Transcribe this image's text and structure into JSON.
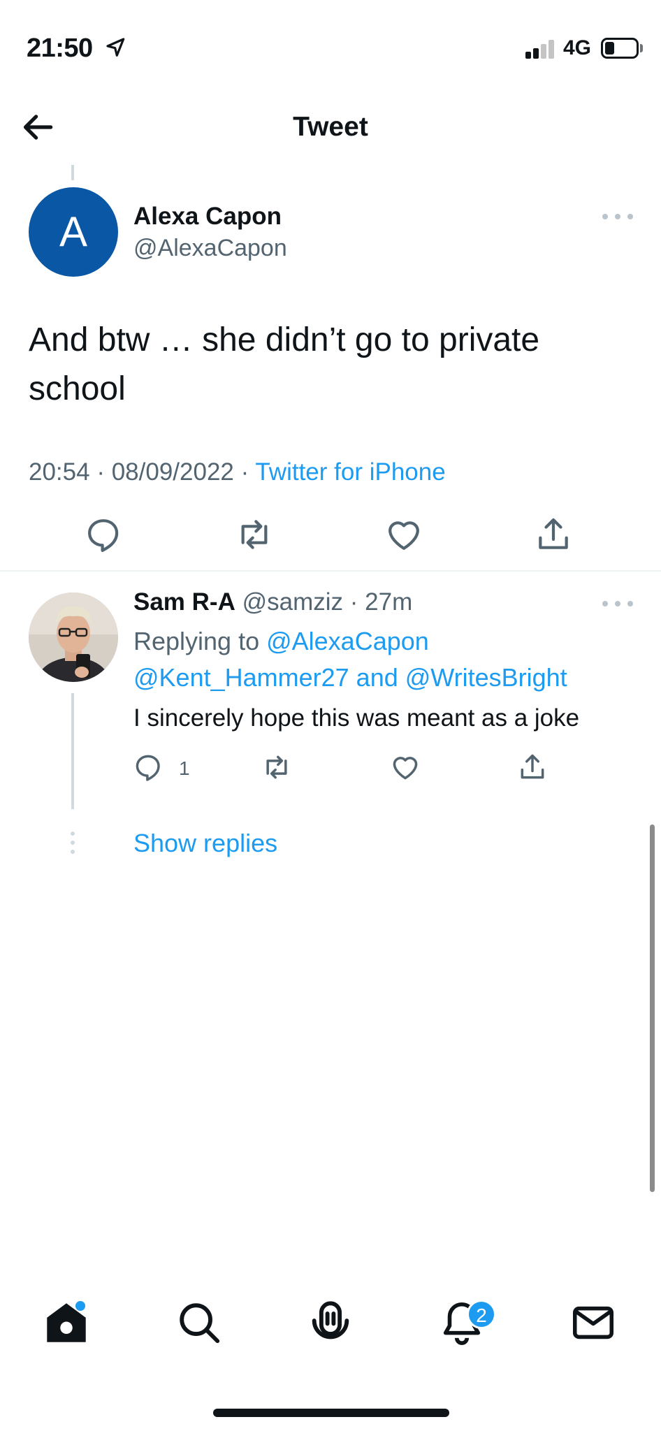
{
  "status_bar": {
    "time": "21:50",
    "network": "4G",
    "icons": [
      "location-arrow-icon",
      "signal-icon",
      "battery-icon"
    ]
  },
  "header": {
    "title": "Tweet",
    "back_icon": "arrow-left-icon"
  },
  "main_tweet": {
    "avatar_letter": "A",
    "avatar_color": "#0a57a6",
    "name": "Alexa Capon",
    "handle": "@AlexaCapon",
    "text": "And btw … she didn’t go to private school",
    "time": "20:54",
    "separator": " · ",
    "date": "08/09/2022",
    "source": "Twitter for iPhone",
    "actions": [
      "reply-icon",
      "retweet-icon",
      "like-icon",
      "share-icon"
    ]
  },
  "reply": {
    "name": "Sam R-A",
    "handle": "@samziz",
    "time_ago": "27m",
    "replying_prefix": "Replying to ",
    "mention_1": "@AlexaCapon",
    "mention_2_and_3": "@Kent_Hammer27 and @WritesBright",
    "text": "I sincerely hope this was meant as a joke",
    "reply_count": "1"
  },
  "show_replies": "Show replies",
  "tab_bar": {
    "tabs": [
      "home-icon",
      "search-icon",
      "spaces-icon",
      "notifications-icon",
      "messages-icon"
    ],
    "notification_badge": "2"
  },
  "colors": {
    "accent": "#1d9bf0",
    "secondary_text": "#536471",
    "primary_text": "#0f1419"
  }
}
